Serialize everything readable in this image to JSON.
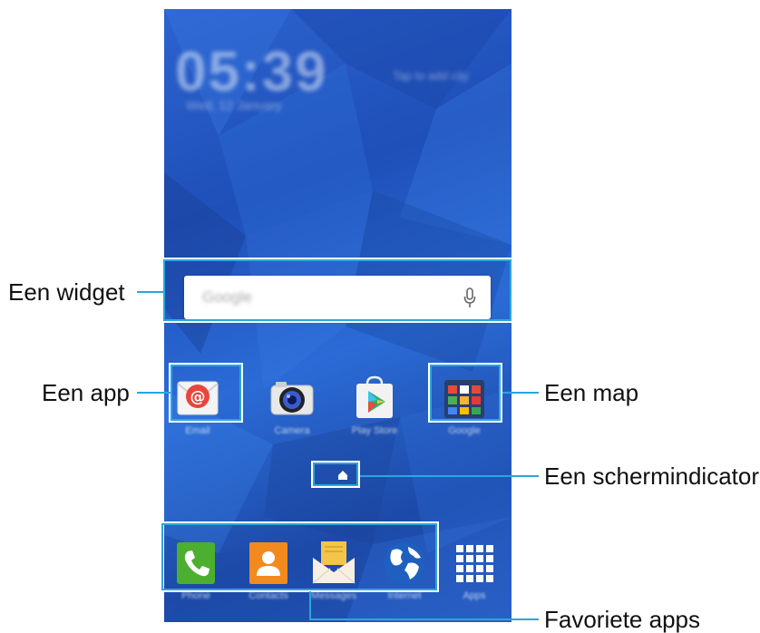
{
  "callouts": {
    "widget": "Een widget",
    "app": "Een app",
    "folder": "Een map",
    "screen_indicator": "Een schermindicator",
    "favorites": "Favoriete apps"
  },
  "lockscreen": {
    "clock": "05:39",
    "date": "Wed, 12 January",
    "weather": "Tap to add city"
  },
  "search_widget": {
    "label": "Google",
    "icon": "microphone-icon"
  },
  "apps": [
    {
      "label": "Email",
      "icon": "email-icon"
    },
    {
      "label": "Camera",
      "icon": "camera-icon"
    },
    {
      "label": "Play Store",
      "icon": "play-store-icon"
    },
    {
      "label": "Google",
      "icon": "folder-icon"
    }
  ],
  "dock": [
    {
      "label": "Phone",
      "icon": "phone-icon"
    },
    {
      "label": "Contacts",
      "icon": "contacts-icon"
    },
    {
      "label": "Messages",
      "icon": "messages-icon"
    },
    {
      "label": "Internet",
      "icon": "internet-icon"
    },
    {
      "label": "Apps",
      "icon": "apps-grid-icon"
    }
  ],
  "colors": {
    "callout_line": "#2aa6de",
    "wallpaper": "#2457bd"
  }
}
